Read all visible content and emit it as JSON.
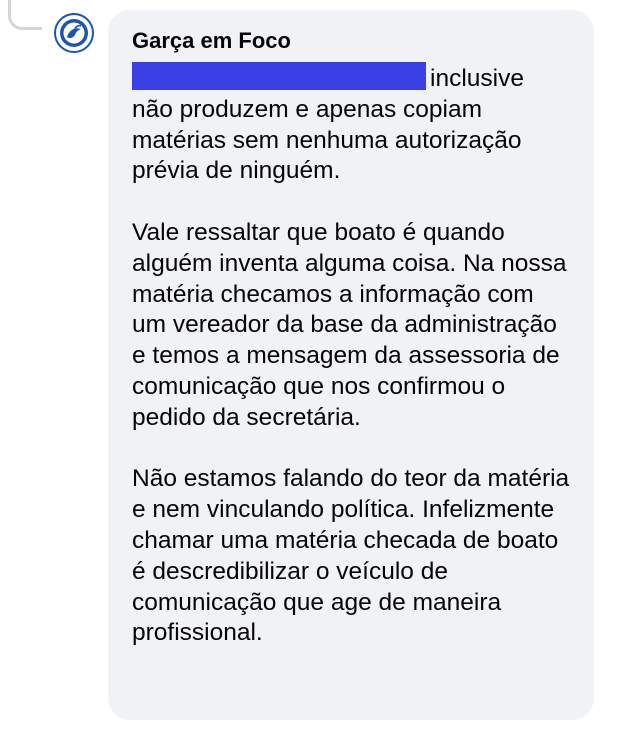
{
  "comment": {
    "author": "Garça em Foco",
    "first_line_text": "inclusive",
    "paragraphs": [
      "não produzem e apenas copiam matérias sem nenhuma autorização prévia de ninguém.",
      "Vale ressaltar que boato é quando alguém inventa alguma coisa. Na nossa matéria checamos a informação com um vereador da base da administração e temos a mensagem da assessoria de comunicação que nos confirmou o pedido da secretária.",
      "Não estamos falando do teor da matéria e nem vinculando política. Infelizmente chamar uma matéria checada de boato é descredibilizar o veículo de comunicação que age de maneira profissional."
    ],
    "redaction_color": "#3b3fe6",
    "bubble_color": "#f0f2f5",
    "avatar_accent": "#1a56b0",
    "avatar_icon": "bird-logo-icon"
  }
}
